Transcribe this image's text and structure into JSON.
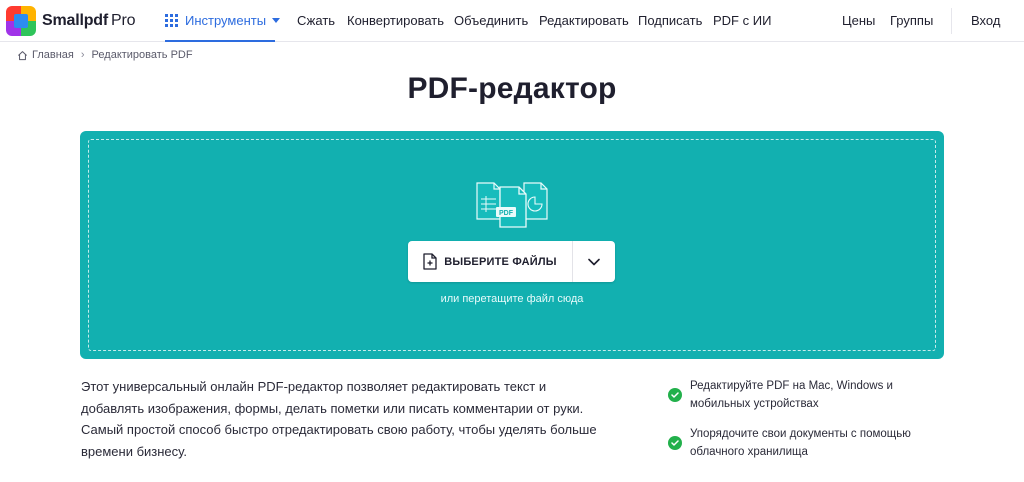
{
  "header": {
    "logo_text": "Smallpdf",
    "logo_pro": "Pro",
    "tools_label": "Инструменты",
    "nav": [
      {
        "label": "Сжать"
      },
      {
        "label": "Конвертировать"
      },
      {
        "label": "Объединить"
      },
      {
        "label": "Редактировать"
      },
      {
        "label": "Подписать"
      },
      {
        "label": "PDF с ИИ"
      }
    ],
    "prices_label": "Цены",
    "groups_label": "Группы",
    "login_label": "Вход"
  },
  "breadcrumb": {
    "home": "Главная",
    "separator": "›",
    "current": "Редактировать PDF"
  },
  "main": {
    "title": "PDF-редактор",
    "choose_files_label": "ВЫБЕРИТЕ ФАЙЛЫ",
    "drop_hint": "или перетащите файл сюда",
    "illustration_badge": "PDF",
    "description": "Этот универсальный онлайн PDF-редактор позволяет редактировать текст и добавлять изображения, формы, делать пометки или писать комментарии от руки. Самый простой способ быстро отредактировать свою работу, чтобы уделять больше времени бизнесу.",
    "features": [
      {
        "text": "Редактируйте PDF на Mac, Windows и мобильных устройствах"
      },
      {
        "text": "Упорядочите свои документы с помощью облачного хранилища"
      }
    ]
  },
  "colors": {
    "accent": "#2d6cdf",
    "dropzone": "#12b0b0",
    "check": "#22b04b"
  }
}
